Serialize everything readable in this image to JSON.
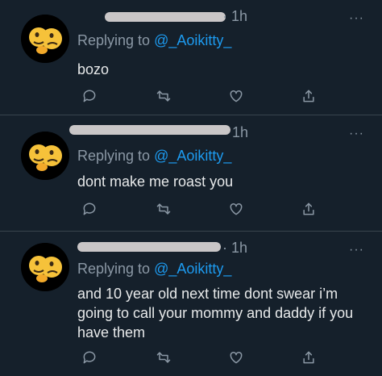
{
  "tweets": [
    {
      "time": "· 1h",
      "replying_prefix": "Replying to ",
      "replying_handle": "@_Aoikitty_",
      "text": "bozo",
      "more": "···"
    },
    {
      "time": "1h",
      "replying_prefix": "Replying to ",
      "replying_handle": "@_Aoikitty_",
      "text": "dont make me roast you",
      "more": "···"
    },
    {
      "time": "· 1h",
      "replying_prefix": "Replying to ",
      "replying_handle": "@_Aoikitty_",
      "text": "and 10 year old next time dont swear i’m going to call your mommy and daddy if you have them",
      "more": "···"
    }
  ],
  "icons": [
    "avatar-emoji-icon",
    "reply-icon",
    "retweet-icon",
    "like-icon",
    "share-icon",
    "more-icon"
  ],
  "colors": {
    "background": "#15202b",
    "muted": "#8b98a5",
    "link": "#1d9bf0",
    "divider": "#38444d"
  }
}
